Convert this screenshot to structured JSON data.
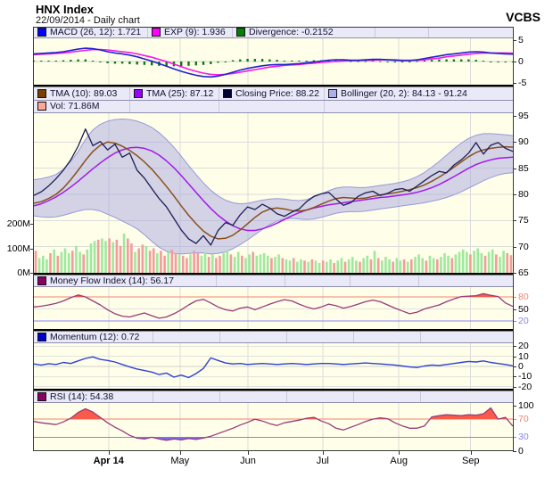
{
  "header": {
    "title": "HNX Index",
    "subtitle": "22/09/2014 - Daily chart",
    "brand": "VCBS"
  },
  "colors": {
    "panel_bg": "#fefee9",
    "legend_bg": "#e9e9f7",
    "grid": "#dcdcdc",
    "macd_line": "#2020d0",
    "exp_line": "#f318e8",
    "divergence_bar": "#0a7a0a",
    "closing_line": "#1d1d55",
    "tma10_line": "#8a4f1d",
    "tma25_line": "#a21ae8",
    "bollinger_fill": "rgba(160,160,225,0.45)",
    "bollinger_edge": "#9898dc",
    "volume_up": "#9fe89f",
    "volume_down": "#f59b9b",
    "mfi_line": "#993b79",
    "momentum_line": "#2f43cf",
    "rsi_line": "#993b79",
    "overbought_fill": "#fa5a49",
    "oversold_fill": "#7b6bee",
    "overbought_line": "#f4836f",
    "oversold_line": "#8585f2",
    "label_red": "#f4836f",
    "label_blue": "#8585f2"
  },
  "legend_rows": {
    "macd": [
      {
        "swatch": "#0000ff",
        "text": "MACD (26, 12): 1.721"
      },
      {
        "swatch": "#ff00ff",
        "text": "EXP (9): 1.936"
      },
      {
        "swatch": "#008000",
        "text": "Divergence: -0.2152"
      }
    ],
    "main1": [
      {
        "swatch": "#7b3f00",
        "text": "TMA (10): 89.03"
      },
      {
        "swatch": "#9900ff",
        "text": "TMA (25): 87.12"
      },
      {
        "swatch": "#000033",
        "text": "Closing Price: 88.22"
      },
      {
        "swatch": "#aab0ea",
        "text": "Bollinger (20, 2): 84.13 - 91.24"
      }
    ],
    "main2": [
      {
        "swatch": "#ffa898",
        "text": "Vol: 71.86M"
      }
    ],
    "mfi": [
      {
        "swatch": "#880066",
        "text": "Money Flow Index (14): 56.17"
      }
    ],
    "mom": [
      {
        "swatch": "#0000cc",
        "text": "Momentum (12): 0.72"
      }
    ],
    "rsi": [
      {
        "swatch": "#880066",
        "text": "RSI (14): 54.38"
      }
    ]
  },
  "x_axis": {
    "months": [
      {
        "label": "Apr 14",
        "frac": 0.156,
        "bold": true
      },
      {
        "label": "May",
        "frac": 0.305,
        "bold": false
      },
      {
        "label": "Jun",
        "frac": 0.447,
        "bold": false
      },
      {
        "label": "Jul",
        "frac": 0.603,
        "bold": false
      },
      {
        "label": "Aug",
        "frac": 0.762,
        "bold": false
      },
      {
        "label": "Sep",
        "frac": 0.912,
        "bold": false
      }
    ]
  },
  "y_axes": {
    "macd": [
      {
        "v": 5,
        "label": "5"
      },
      {
        "v": 0,
        "label": "0"
      },
      {
        "v": -5,
        "label": "-5"
      }
    ],
    "price": [
      {
        "v": 95,
        "label": "95"
      },
      {
        "v": 90,
        "label": "90"
      },
      {
        "v": 85,
        "label": "85"
      },
      {
        "v": 80,
        "label": "80"
      },
      {
        "v": 75,
        "label": "75"
      },
      {
        "v": 70,
        "label": "70"
      },
      {
        "v": 65,
        "label": "65"
      }
    ],
    "volume": [
      {
        "v": 200,
        "label": "200M"
      },
      {
        "v": 100,
        "label": "100M"
      },
      {
        "v": 0,
        "label": "0M"
      }
    ],
    "mfi": [
      {
        "v": 80,
        "label": "80",
        "color": "#f4836f"
      },
      {
        "v": 50,
        "label": "50"
      },
      {
        "v": 20,
        "label": "20",
        "color": "#8585f2"
      }
    ],
    "momentum": [
      {
        "v": 20,
        "label": "20"
      },
      {
        "v": 10,
        "label": "10"
      },
      {
        "v": 0,
        "label": "0"
      },
      {
        "v": -10,
        "label": "-10"
      },
      {
        "v": -20,
        "label": "-20"
      }
    ],
    "rsi": [
      {
        "v": 100,
        "label": "100"
      },
      {
        "v": 70,
        "label": "70",
        "color": "#f4836f"
      },
      {
        "v": 30,
        "label": "30",
        "color": "#8585f2"
      },
      {
        "v": 0,
        "label": "0"
      }
    ]
  },
  "chart_data": [
    {
      "id": "macd_panel",
      "type": "line",
      "ylim": [
        -5,
        5
      ],
      "yticks": [
        5,
        0,
        -5
      ],
      "legend_values": {
        "macd": 1.721,
        "exp": 1.936,
        "divergence": -0.2152
      },
      "series": [
        {
          "name": "MACD (26, 12)",
          "render": "line",
          "values": [
            1.8,
            1.9,
            2.0,
            2.1,
            2.3,
            2.6,
            2.9,
            3.1,
            3.0,
            2.7,
            2.3,
            2.0,
            1.8,
            1.5,
            1.1,
            0.6,
            0.1,
            -0.5,
            -1.1,
            -1.7,
            -2.3,
            -2.8,
            -3.2,
            -3.5,
            -3.6,
            -3.4,
            -3.0,
            -2.5,
            -2.0,
            -1.6,
            -1.3,
            -1.0,
            -0.8,
            -0.7,
            -0.7,
            -0.6,
            -0.5,
            -0.3,
            -0.1,
            0.1,
            0.3,
            0.4,
            0.4,
            0.3,
            0.3,
            0.4,
            0.5,
            0.5,
            0.4,
            0.3,
            0.2,
            0.2,
            0.4,
            0.7,
            1.0,
            1.3,
            1.6,
            1.8,
            2.0,
            2.2,
            2.3,
            2.2,
            2.0,
            1.9,
            1.8,
            1.721
          ]
        },
        {
          "name": "EXP (9)",
          "render": "line",
          "values": [
            1.6,
            1.7,
            1.8,
            1.9,
            2.0,
            2.2,
            2.4,
            2.6,
            2.8,
            2.8,
            2.7,
            2.5,
            2.3,
            2.1,
            1.8,
            1.4,
            1.0,
            0.5,
            0.0,
            -0.6,
            -1.2,
            -1.8,
            -2.3,
            -2.7,
            -3.0,
            -3.1,
            -3.0,
            -2.8,
            -2.5,
            -2.2,
            -1.9,
            -1.6,
            -1.3,
            -1.1,
            -0.9,
            -0.8,
            -0.7,
            -0.5,
            -0.4,
            -0.2,
            -0.1,
            0.0,
            0.1,
            0.2,
            0.2,
            0.3,
            0.3,
            0.4,
            0.4,
            0.4,
            0.3,
            0.3,
            0.3,
            0.4,
            0.6,
            0.8,
            1.1,
            1.3,
            1.5,
            1.7,
            1.9,
            2.0,
            2.0,
            2.0,
            2.0,
            1.936
          ]
        },
        {
          "name": "Divergence",
          "render": "bar",
          "derived": "MACD minus EXP"
        }
      ]
    },
    {
      "id": "price_panel",
      "type": "line+band+bar",
      "ylim": [
        65,
        95
      ],
      "yticks": [
        95,
        90,
        85,
        80,
        75,
        70,
        65
      ],
      "legend_values": {
        "tma10": 89.03,
        "tma25": 87.12,
        "closing": 88.22,
        "bollinger": "84.13 - 91.24",
        "vol": "71.86M"
      },
      "series": [
        {
          "name": "Closing Price",
          "render": "line",
          "values": [
            79.8,
            80.5,
            81.6,
            83.0,
            84.6,
            86.6,
            89.2,
            92.5,
            89.3,
            90.1,
            88.5,
            89.6,
            87.1,
            87.9,
            84.6,
            83.1,
            81.1,
            79.2,
            77.6,
            75.4,
            73.2,
            71.5,
            70.6,
            72.1,
            70.3,
            73.1,
            74.6,
            74.1,
            76.1,
            77.6,
            77.1,
            78.1,
            77.4,
            76.3,
            75.8,
            76.6,
            77.2,
            78.6,
            79.6,
            80.1,
            80.4,
            79.1,
            77.9,
            78.4,
            79.6,
            80.3,
            80.6,
            79.8,
            80.2,
            80.9,
            81.1,
            80.6,
            81.6,
            82.6,
            83.6,
            84.4,
            84.1,
            85.6,
            86.6,
            87.9,
            89.9,
            87.7,
            89.4,
            89.9,
            88.8,
            88.22
          ]
        },
        {
          "name": "TMA (10)",
          "render": "line",
          "values": [
            78.3,
            78.6,
            79.2,
            80.0,
            81.2,
            82.8,
            84.6,
            86.5,
            88.2,
            89.4,
            90.0,
            89.8,
            89.2,
            88.4,
            87.4,
            86.2,
            84.8,
            83.2,
            81.5,
            79.7,
            77.8,
            76.0,
            74.4,
            73.0,
            72.0,
            71.5,
            71.6,
            72.2,
            73.2,
            74.4,
            75.6,
            76.6,
            77.2,
            77.4,
            77.2,
            76.9,
            76.8,
            77.0,
            77.5,
            78.1,
            78.7,
            79.2,
            79.4,
            79.3,
            79.2,
            79.3,
            79.6,
            79.9,
            80.1,
            80.3,
            80.6,
            80.9,
            81.3,
            81.8,
            82.5,
            83.3,
            84.2,
            85.2,
            86.2,
            87.2,
            88.0,
            88.5,
            88.8,
            89.0,
            89.1,
            89.03
          ]
        },
        {
          "name": "TMA (25)",
          "render": "line",
          "values": [
            77.8,
            78.2,
            78.8,
            79.5,
            80.4,
            81.4,
            82.5,
            83.7,
            84.9,
            86.0,
            87.0,
            87.9,
            88.5,
            88.9,
            89.0,
            88.8,
            88.3,
            87.5,
            86.4,
            85.1,
            83.6,
            82.0,
            80.4,
            78.8,
            77.3,
            76.0,
            74.9,
            74.0,
            73.4,
            73.1,
            73.1,
            73.4,
            73.9,
            74.5,
            75.2,
            75.9,
            76.5,
            77.0,
            77.4,
            77.7,
            78.0,
            78.2,
            78.4,
            78.6,
            78.8,
            79.0,
            79.2,
            79.4,
            79.5,
            79.7,
            79.9,
            80.1,
            80.4,
            80.8,
            81.3,
            81.9,
            82.6,
            83.4,
            84.2,
            85.0,
            85.7,
            86.2,
            86.6,
            86.9,
            87.0,
            87.12
          ]
        },
        {
          "name": "Bollinger Upper",
          "render": "band-edge",
          "values": [
            82.8,
            83.0,
            83.3,
            83.8,
            84.8,
            86.3,
            88.2,
            90.5,
            92.3,
            93.4,
            94.0,
            94.3,
            94.4,
            94.3,
            94.0,
            93.5,
            92.8,
            91.8,
            90.5,
            89.0,
            87.3,
            85.5,
            83.8,
            82.2,
            80.8,
            79.7,
            78.9,
            78.4,
            78.2,
            78.3,
            78.6,
            78.9,
            79.1,
            79.2,
            79.1,
            78.9,
            78.8,
            79.0,
            79.5,
            80.1,
            80.7,
            81.2,
            81.4,
            81.4,
            81.3,
            81.3,
            81.5,
            81.7,
            81.9,
            82.1,
            82.4,
            82.8,
            83.4,
            84.2,
            85.2,
            86.3,
            87.5,
            88.7,
            89.8,
            90.7,
            91.3,
            91.6,
            91.6,
            91.5,
            91.4,
            91.24
          ]
        },
        {
          "name": "Bollinger Lower",
          "render": "band-edge",
          "values": [
            75.9,
            75.7,
            75.6,
            75.7,
            76.0,
            76.4,
            76.8,
            77.1,
            77.1,
            76.8,
            76.2,
            75.6,
            74.9,
            74.2,
            73.4,
            72.3,
            71.0,
            69.9,
            69.1,
            68.7,
            68.6,
            68.7,
            68.8,
            68.8,
            68.6,
            68.7,
            69.0,
            69.6,
            70.4,
            71.3,
            72.3,
            73.3,
            74.2,
            74.9,
            75.3,
            75.4,
            75.3,
            75.2,
            75.3,
            75.6,
            76.0,
            76.4,
            76.6,
            76.7,
            76.7,
            76.8,
            77.0,
            77.2,
            77.4,
            77.6,
            77.8,
            78.0,
            78.2,
            78.4,
            78.7,
            79.0,
            79.4,
            79.9,
            80.5,
            81.2,
            81.9,
            82.6,
            83.2,
            83.7,
            84.0,
            84.13
          ]
        }
      ],
      "volume": {
        "unit": "millions",
        "yticks": [
          200,
          100,
          0
        ],
        "values": [
          90,
          60,
          70,
          55,
          80,
          95,
          70,
          85,
          100,
          80,
          90,
          110,
          85,
          75,
          95,
          120,
          130,
          135,
          140,
          130,
          140,
          125,
          135,
          110,
          160,
          140,
          120,
          85,
          100,
          115,
          110,
          90,
          100,
          80,
          90,
          70,
          85,
          95,
          80,
          75,
          70,
          60,
          75,
          90,
          80,
          70,
          85,
          65,
          75,
          60,
          70,
          80,
          95,
          75,
          65,
          85,
          70,
          60,
          75,
          85,
          70,
          75,
          80,
          70,
          60,
          65,
          75,
          60,
          55,
          50,
          60,
          45,
          55,
          50,
          45,
          55,
          50,
          40,
          50,
          45,
          55,
          40,
          50,
          60,
          45,
          55,
          65,
          50,
          45,
          60,
          70,
          55,
          90,
          60,
          50,
          65,
          55,
          45,
          60,
          50,
          55,
          45,
          55,
          65,
          75,
          60,
          50,
          70,
          60,
          55,
          65,
          80,
          70,
          60,
          75,
          85,
          95,
          85,
          75,
          90,
          100,
          80,
          70,
          85,
          95,
          75,
          65,
          90,
          80,
          71.86
        ],
        "direction": "rgggrgrgggrggrgggrggrgrrgrrgrrgrrgrrgrrgrrgrrggrgrrggrggrggrggggrggrggrggrgrggrggrggrgggrggrgrgggrggrgrgggrggrgggrggggrgggrggrggrr"
      }
    },
    {
      "id": "mfi_panel",
      "type": "line",
      "ylim": [
        0,
        100
      ],
      "overbought": 80,
      "oversold": 20,
      "yticks": [
        80,
        50,
        20
      ],
      "legend_values": {
        "mfi": 56.17
      },
      "values": [
        55,
        57,
        60,
        64,
        70,
        78,
        85,
        80,
        70,
        60,
        48,
        38,
        32,
        30,
        35,
        40,
        33,
        27,
        30,
        38,
        48,
        60,
        70,
        74,
        65,
        55,
        48,
        45,
        52,
        55,
        48,
        55,
        62,
        68,
        73,
        70,
        62,
        55,
        50,
        55,
        62,
        58,
        52,
        56,
        62,
        68,
        72,
        68,
        60,
        52,
        45,
        38,
        42,
        50,
        55,
        60,
        68,
        75,
        81,
        82,
        83,
        88,
        84,
        81,
        65,
        56.17
      ]
    },
    {
      "id": "momentum_panel",
      "type": "line",
      "ylim": [
        -22,
        23
      ],
      "yticks": [
        20,
        10,
        0,
        -10,
        -20
      ],
      "legend_values": {
        "momentum": 0.72
      },
      "values": [
        2.5,
        1.5,
        2.8,
        2.0,
        4.0,
        3.0,
        5.5,
        8.0,
        9.5,
        7.0,
        6.0,
        4.5,
        2.0,
        -0.5,
        -2.5,
        -4.0,
        -5.5,
        -8.0,
        -6.5,
        -10.5,
        -8.5,
        -11.0,
        -7.0,
        -2.0,
        8.5,
        6.0,
        3.5,
        2.5,
        3.0,
        2.0,
        2.5,
        3.0,
        2.5,
        2.0,
        2.5,
        3.0,
        2.5,
        2.0,
        2.5,
        3.0,
        3.0,
        2.5,
        2.0,
        2.5,
        3.0,
        3.5,
        3.0,
        2.5,
        2.0,
        1.5,
        0.5,
        -0.5,
        -1.0,
        0.5,
        1.5,
        1.0,
        2.0,
        3.0,
        4.0,
        5.0,
        4.5,
        5.5,
        4.0,
        3.0,
        2.0,
        0.72
      ]
    },
    {
      "id": "rsi_panel",
      "type": "line",
      "ylim": [
        0,
        100
      ],
      "overbought": 70,
      "oversold": 30,
      "yticks": [
        100,
        70,
        30,
        0
      ],
      "legend_values": {
        "rsi": 54.38
      },
      "values": [
        65,
        62,
        60,
        58,
        64,
        72,
        85,
        93,
        86,
        74,
        62,
        52,
        44,
        34,
        28,
        26,
        30,
        26,
        23,
        26,
        24,
        27,
        25,
        28,
        32,
        38,
        44,
        50,
        57,
        63,
        70,
        66,
        60,
        56,
        62,
        65,
        68,
        72,
        74,
        66,
        60,
        50,
        46,
        52,
        58,
        65,
        70,
        73,
        71,
        62,
        55,
        50,
        50,
        55,
        75,
        78,
        80,
        79,
        78,
        80,
        79,
        82,
        95,
        70,
        74,
        54.38
      ]
    }
  ]
}
